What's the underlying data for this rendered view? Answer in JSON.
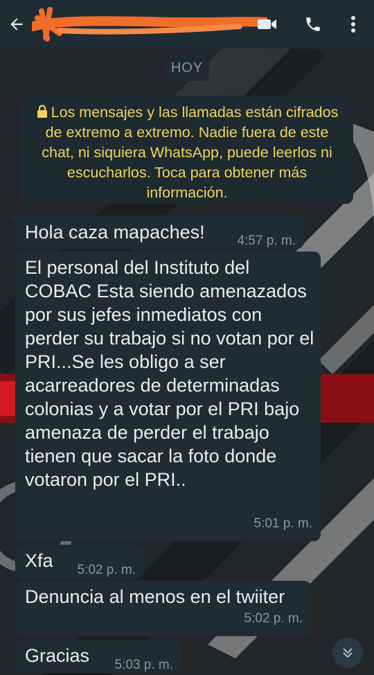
{
  "header": {
    "back_icon": "arrow-left-icon",
    "contact_name": "",
    "video_icon": "video-camera-icon",
    "call_icon": "phone-icon",
    "menu_icon": "more-vertical-icon"
  },
  "date_chip": "HOY",
  "encryption_notice": "Los mensajes y las llamadas están cifrados de extremo a extremo. Nadie fuera de este chat, ni siquiera WhatsApp, puede leerlos ni escucharlos. Toca para obtener más información.",
  "messages": [
    {
      "text": "Hola caza mapaches!",
      "time": "4:57 p. m."
    },
    {
      "text": "El personal del Instituto del COBAC Esta siendo amenazados por sus jefes inmediatos con perder su trabajo si no votan por el PRI...Se les obligo a ser acarreadores de determinadas colonias y a votar por el PRI bajo amenaza de perder el trabajo tienen que sacar la foto donde votaron por el PRI..",
      "time": "5:01 p. m."
    },
    {
      "text": "Xfa",
      "time": "5:02 p. m."
    },
    {
      "text": "Denuncia al menos en el twiiter",
      "time": "5:02 p. m."
    },
    {
      "text": "Gracias",
      "time": "5:03 p. m."
    }
  ],
  "scroll_down_icon": "double-chevron-down-icon",
  "colors": {
    "header_bg": "#1f2c34",
    "bubble_bg": "#1f2c33",
    "notice_text": "#f4d35e",
    "timestamp": "#8696a0",
    "redaction": "#f26d2a"
  }
}
